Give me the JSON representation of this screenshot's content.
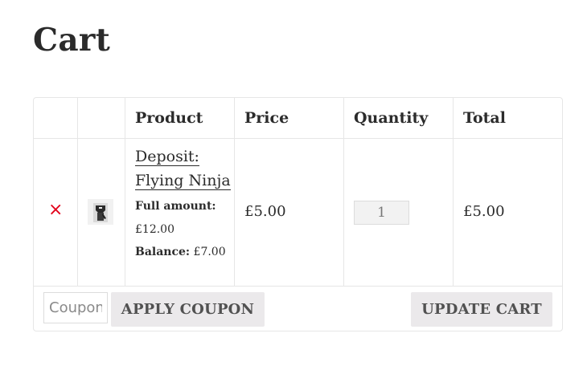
{
  "page": {
    "title": "Cart"
  },
  "table": {
    "headers": {
      "product": "Product",
      "price": "Price",
      "quantity": "Quantity",
      "total": "Total"
    },
    "rows": [
      {
        "remove_symbol": "×",
        "product_name_line1": "Deposit:",
        "product_name_line2": "Flying Ninja",
        "full_amount_label": "Full amount:",
        "full_amount_value": "£12.00",
        "balance_label": "Balance:",
        "balance_value": "£7.00",
        "price": "£5.00",
        "quantity": "1",
        "total": "£5.00",
        "thumbnail_icon": "product-thumbnail-icon"
      }
    ]
  },
  "actions": {
    "coupon_placeholder": "Coupon code",
    "apply_coupon_label": "APPLY COUPON",
    "update_cart_label": "UPDATE CART"
  },
  "colors": {
    "remove": "#e2001a",
    "button_bg": "#ebe9eb",
    "border": "#e6e6e6"
  }
}
